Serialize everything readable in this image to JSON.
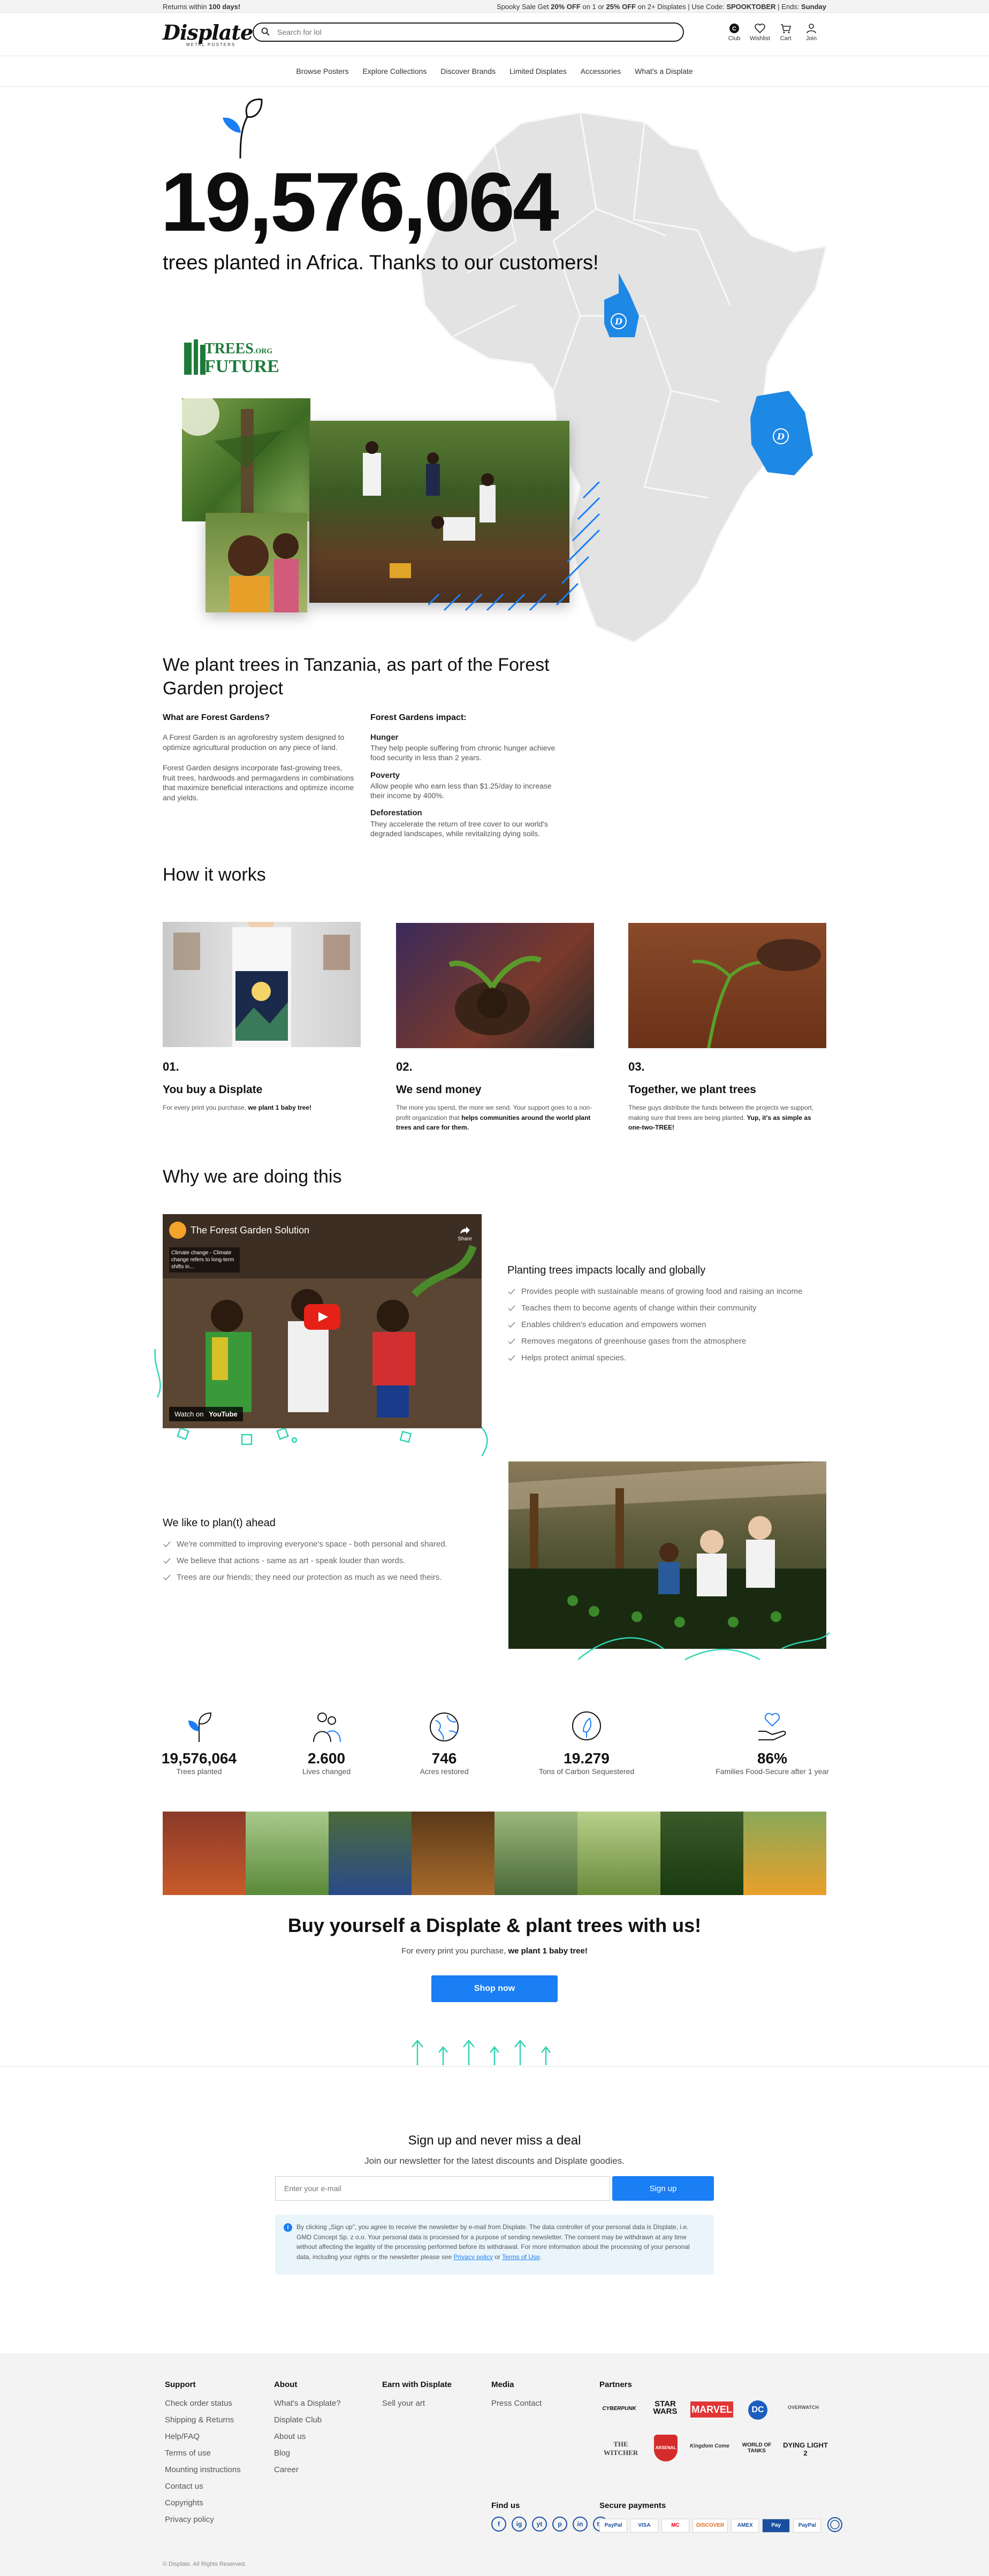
{
  "topbar": {
    "returns_pre": "Returns within ",
    "returns_bold": "100 days!",
    "promo_pre": "Spooky Sale Get ",
    "promo_off1": "20% OFF",
    "promo_mid1": " on 1 or ",
    "promo_off2": "25% OFF",
    "promo_mid2": " on 2+ Displates | Use Code: ",
    "promo_code": "SPOOKTOBER",
    "promo_ends": " | Ends: ",
    "promo_day": "Sunday"
  },
  "header": {
    "logo": "Displate",
    "logo_sub": "METAL POSTERS",
    "search_placeholder": "Search for lol",
    "club_label": "Club",
    "wishlist_label": "Wishlist",
    "cart_label": "Cart",
    "join_label": "Join"
  },
  "nav": {
    "items": [
      "Browse Posters",
      "Explore Collections",
      "Discover Brands",
      "Limited Displates",
      "Accessories",
      "What's a Displate"
    ]
  },
  "hero": {
    "number": "19,576,064",
    "line": "trees planted in Africa. Thanks to our customers!",
    "partner_logo_l1": "TREES",
    "partner_logo_l2": ".ORG",
    "partner_logo_l3": "FUTURE",
    "map_marker": "D"
  },
  "tanzania": {
    "title": "We plant trees in Tanzania, as part of the Forest Garden project",
    "q_title": "What are Forest Gardens?",
    "q_p1": "A Forest Garden is an agroforestry system designed to optimize agricultural production on any piece of land.",
    "q_p2": "Forest Garden designs incorporate fast-growing trees, fruit trees, hardwoods and permagardens in combinations that maximize beneficial interactions and optimize income and yields.",
    "impact_title": "Forest Gardens impact:",
    "impacts": [
      {
        "title": "Hunger",
        "body": "They help people suffering from chronic hunger achieve food security in less than 2 years."
      },
      {
        "title": "Poverty",
        "body": "Allow people who earn less than $1.25/day to increase their income by 400%."
      },
      {
        "title": "Deforestation",
        "body": "They accelerate the return of tree cover to our world's degraded landscapes, while revitalizing dying soils."
      }
    ]
  },
  "how": {
    "title": "How it works",
    "steps": [
      {
        "num": "01.",
        "title": "You buy a Displate",
        "desc": "For every print you purchase, ",
        "desc_bold": "we plant 1 baby tree!",
        "desc_tail": ""
      },
      {
        "num": "02.",
        "title": "We send money",
        "desc": "The more you spend, the more we send. Your support goes to a non-profit organization that ",
        "desc_bold": "helps communities around the world plant trees and care for them.",
        "desc_tail": ""
      },
      {
        "num": "03.",
        "title": "Together, we plant trees",
        "desc": "These guys distribute the funds between the projects we support, making sure that trees are being planted. ",
        "desc_bold": "Yup, it's as simple as one-two-TREE!",
        "desc_tail": ""
      }
    ]
  },
  "why": {
    "title": "Why we are doing this",
    "video_title": "The Forest Garden Solution",
    "video_caption": "Climate change - Climate change refers to long-term shifts in...",
    "video_watch": "Watch on",
    "video_brand": "YouTube",
    "video_share": "Share",
    "impacts_title": "Planting trees impacts locally and globally",
    "impacts": [
      "Provides people with sustainable means of growing food and raising an income",
      "Teaches them to become agents of change within their community",
      "Enables children's education and empowers women",
      "Removes megatons of greenhouse gases from the atmosphere",
      "Helps protect animal species."
    ],
    "ahead_title": "We like to plan(t) ahead",
    "ahead": [
      "We're committed to improving everyone's space - both personal and shared.",
      "We believe that actions - same as art - speak louder than words.",
      "Trees are our friends; they need our protection as much as we need theirs."
    ]
  },
  "stats": [
    {
      "icon": "sprout-icon",
      "num": "19,576,064",
      "label": "Trees planted"
    },
    {
      "icon": "people-icon",
      "num": "2.600",
      "label": "Lives changed"
    },
    {
      "icon": "globe-icon",
      "num": "746",
      "label": "Acres restored"
    },
    {
      "icon": "leaf-drop-icon",
      "num": "19.279",
      "label": "Tons of Carbon Sequestered"
    },
    {
      "icon": "hand-heart-icon",
      "num": "86%",
      "label": "Families Food-Secure after 1 year"
    }
  ],
  "cta": {
    "title": "Buy yourself a Displate & plant trees with us!",
    "sub": "For every print you purchase, ",
    "sub_bold": "we plant 1 baby tree!",
    "button": "Shop now"
  },
  "newsletter": {
    "title": "Sign up and never miss a deal",
    "sub": "Join our newsletter for the latest discounts and Displate goodies.",
    "placeholder": "Enter your e-mail",
    "button": "Sign up",
    "consent": "By clicking „Sign up\", you agree to receive the newsletter by e-mail from Displate. The data controller of your personal data is Displate, i.e. GMD Concept Sp. z o.o. Your personal data is processed for a purpose of sending newsletter. The consent may be withdrawn at any time without affecting the legality of the processing performed before its withdrawal. For more information about the processing of your personal data, including your rights or the newsletter please see ",
    "privacy": "Privacy policy",
    "or": " or ",
    "terms": "Terms of Use",
    "end": "."
  },
  "footer": {
    "support_title": "Support",
    "support": [
      "Check order status",
      "Shipping & Returns",
      "Help/FAQ",
      "Terms of use",
      "Mounting instructions",
      "Contact us",
      "Copyrights",
      "Privacy policy"
    ],
    "about_title": "About",
    "about": [
      "What's a Displate?",
      "Displate Club",
      "About us",
      "Blog",
      "Career"
    ],
    "earn_title": "Earn with Displate",
    "earn": [
      "Sell your art"
    ],
    "media_title": "Media",
    "media": [
      "Press Contact"
    ],
    "partners_title": "Partners",
    "partners": [
      "CYBERPUNK",
      "STAR WARS",
      "MARVEL",
      "DC",
      "OVERWATCH",
      "THE WITCHER",
      "ARSENAL",
      "Kingdom Come",
      "WORLD OF TANKS",
      "DYING LIGHT 2"
    ],
    "findus_title": "Find us",
    "social": [
      "f",
      "ig",
      "yt",
      "p",
      "in",
      "tw"
    ],
    "payments_title": "Secure payments",
    "payments": [
      "PayPal",
      "VISA",
      "MC",
      "DISCOVER",
      "AMEX",
      "Pay",
      "PayPal"
    ],
    "copyright": "© Displate. All Rights Reserved."
  },
  "colors": {
    "brand_blue": "#1a7ef5",
    "map_gray": "#e2e2e2",
    "map_highlight": "#1e88e5",
    "teal_deco": "#2fd4b4"
  }
}
